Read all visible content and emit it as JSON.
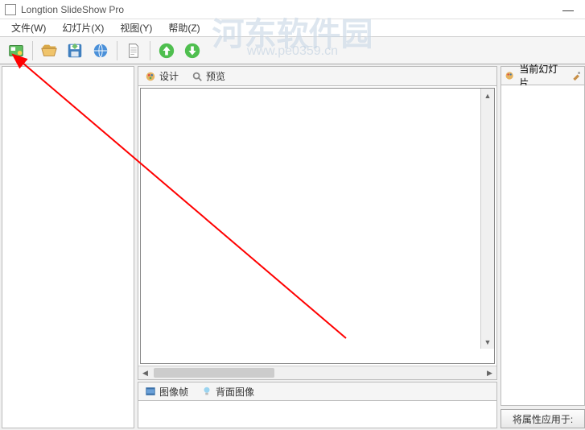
{
  "title": "Longtion SlideShow Pro",
  "watermark": {
    "main": "河东软件园",
    "url": "www.pe0359.cn"
  },
  "menu": {
    "file": "文件(W)",
    "slide": "幻灯片(X)",
    "view": "视图(Y)",
    "help": "帮助(Z)"
  },
  "tabs": {
    "design": "设计",
    "preview": "预览",
    "current_slide": "当前幻灯片",
    "image_frame": "图像帧",
    "back_image": "背面图像"
  },
  "right_panel": {
    "apply_button": "将属性应用于:"
  }
}
